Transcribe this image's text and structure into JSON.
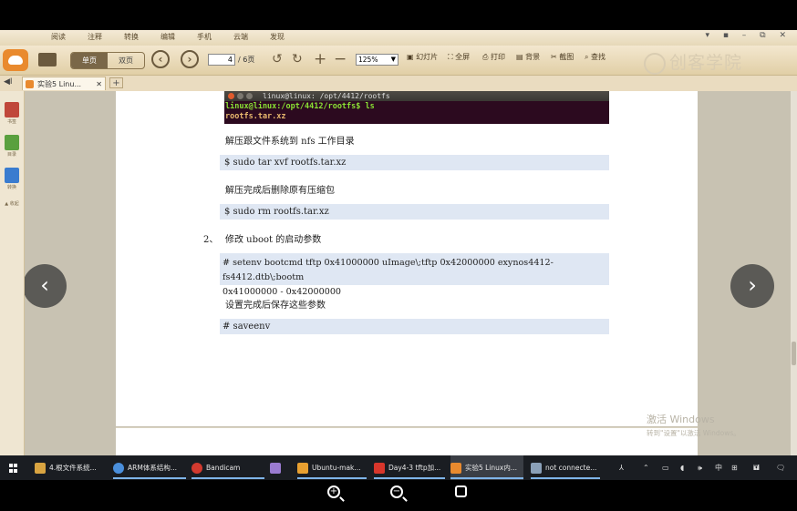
{
  "app": {
    "menu": [
      "阅读",
      "注释",
      "转换",
      "编辑",
      "手机",
      "云端",
      "发现"
    ],
    "window_controls": "▾ ▪ – ⧉ ✕",
    "toolbar": {
      "view_single": "单页",
      "view_double": "双页",
      "prev_icon": "arrow-left-icon",
      "next_icon": "arrow-right-icon",
      "page_current": "4",
      "page_total": "/ 6页",
      "zoom": "125%",
      "slideshow": "幻灯片",
      "fullscreen": "全屏",
      "print": "打印",
      "background": "背景",
      "screenshot": "截图",
      "find": "查找"
    },
    "brand": "创客学院",
    "tab": {
      "back": "◀I",
      "title": "实验5 Linu...",
      "close": "✕",
      "add": "+"
    },
    "sidebar": [
      "书签",
      "目录",
      "转换",
      "▲ 收起"
    ]
  },
  "document": {
    "terminal": {
      "title": "linux@linux: /opt/4412/rootfs",
      "prompt": "linux@linux:/opt/4412/rootfs$ ls",
      "output": "rootfs.tar.xz"
    },
    "p1": "解压跟文件系统到 nfs 工作目录",
    "cmd1": "$ sudo    tar    xvf    rootfs.tar.xz",
    "p2": "解压完成后删除原有压缩包",
    "cmd2": "$ sudo    rm    rootfs.tar.xz",
    "step2_num": "2、",
    "step2_text": "修改 uboot 的启动参数",
    "cmd3_line1": "# setenv bootcmd tftp 0x41000000 uImage\\;tftp 0x42000000 exynos4412-fs4412.dtb\\;bootm",
    "cmd3_line2": "0x41000000 - 0x42000000",
    "p3": "设置完成后保存这些参数",
    "cmd4": "# saveenv"
  },
  "watermark": {
    "line1": "激活 Windows",
    "line2": "转到\"设置\"以激活 Windows。"
  },
  "taskbar": {
    "items": [
      {
        "label": "4.根文件系统...",
        "color": "#d9a441"
      },
      {
        "label": "ARM体系结构...",
        "color": "#4a8fdc"
      },
      {
        "label": "Bandicam",
        "color": "#d23a2f"
      },
      {
        "label": "",
        "color": "#9a7bd0"
      },
      {
        "label": "Ubuntu-mak...",
        "color": "#e8a030"
      },
      {
        "label": "Day4-3 tftp加...",
        "color": "#d8362b"
      },
      {
        "label": "实验5 Linux内...",
        "color": "#e98a2e"
      },
      {
        "label": "not connecte...",
        "color": "#8aa0b8"
      }
    ],
    "tray": [
      "⅄",
      "⌃",
      "▭",
      "◖",
      "🕪",
      "中",
      "⊞",
      "🖬",
      "🗨"
    ]
  },
  "player_controls": {
    "zoom_in": "+",
    "zoom_out": "−"
  }
}
